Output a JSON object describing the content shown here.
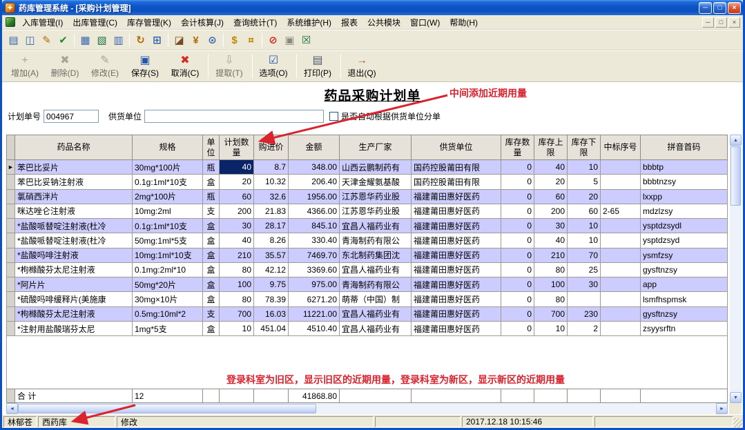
{
  "window": {
    "title": "药库管理系统 - [采购计划管理]",
    "minimize": "─",
    "restore": "□",
    "close": "×"
  },
  "menu": {
    "items": [
      "入库管理(I)",
      "出库管理(C)",
      "库存管理(K)",
      "会计核算(J)",
      "查询统计(T)",
      "系统维护(H)",
      "报表",
      "公共模块",
      "窗口(W)",
      "帮助(H)"
    ],
    "mdi_minimize": "─",
    "mdi_restore": "□",
    "mdi_close": "×"
  },
  "toolbar": {
    "icons": [
      {
        "name": "new-plan-icon",
        "glyph": "▤",
        "color": "#3565b0"
      },
      {
        "name": "copy-plan-icon",
        "glyph": "◫",
        "color": "#3565b0"
      },
      {
        "name": "edit-plan-icon",
        "glyph": "✎",
        "color": "#b06a00"
      },
      {
        "name": "audit-plan-icon",
        "glyph": "✔",
        "color": "#1e8a2e"
      },
      {
        "sep": true
      },
      {
        "name": "notepad-icon",
        "glyph": "▦",
        "color": "#3565b0"
      },
      {
        "name": "excel-export-icon",
        "glyph": "▧",
        "color": "#1e7145"
      },
      {
        "name": "report-icon",
        "glyph": "▥",
        "color": "#3565b0"
      },
      {
        "sep": true
      },
      {
        "name": "refresh-icon",
        "glyph": "↻",
        "color": "#b06a00"
      },
      {
        "name": "data-grid-icon",
        "glyph": "⊞",
        "color": "#3565b0"
      },
      {
        "sep": true
      },
      {
        "name": "image-icon",
        "glyph": "◪",
        "color": "#7a4a20"
      },
      {
        "name": "price-query-icon",
        "glyph": "¥",
        "color": "#b06a00"
      },
      {
        "name": "search-icon",
        "glyph": "⊙",
        "color": "#3565b0"
      },
      {
        "sep": true
      },
      {
        "name": "money-icon",
        "glyph": "$",
        "color": "#c08800"
      },
      {
        "name": "gold-icon",
        "glyph": "¤",
        "color": "#c08800"
      },
      {
        "sep": true
      },
      {
        "name": "stop-icon",
        "glyph": "⊘",
        "color": "#d22c22"
      },
      {
        "name": "save-disk-icon",
        "glyph": "▣",
        "color": "#8a8880"
      },
      {
        "name": "close-grid-icon",
        "glyph": "☒",
        "color": "#1e7145"
      }
    ]
  },
  "actions": [
    {
      "name": "add-button",
      "label": "增加(A)",
      "glyph": "+",
      "color": "#9c9a92",
      "enabled": false
    },
    {
      "name": "delete-button",
      "label": "删除(D)",
      "glyph": "✖",
      "color": "#9c9a92",
      "enabled": false
    },
    {
      "name": "modify-button",
      "label": "修改(E)",
      "glyph": "✎",
      "color": "#9c9a92",
      "enabled": false
    },
    {
      "name": "save-button",
      "label": "保存(S)",
      "glyph": "▣",
      "color": "#2456b0",
      "enabled": true
    },
    {
      "name": "cancel-button",
      "label": "取消(C)",
      "glyph": "✖",
      "color": "#d22c22",
      "enabled": true
    },
    {
      "sep": true
    },
    {
      "name": "extract-button",
      "label": "提取(T)",
      "glyph": "⇩",
      "color": "#9c9a92",
      "enabled": false
    },
    {
      "sep": true
    },
    {
      "name": "options-button",
      "label": "选项(O)",
      "glyph": "☑",
      "color": "#2456b0",
      "enabled": true
    },
    {
      "sep": true
    },
    {
      "name": "print-button",
      "label": "打印(P)",
      "glyph": "▤",
      "color": "#50586e",
      "enabled": true
    },
    {
      "sep": true
    },
    {
      "name": "exit-button",
      "label": "退出(Q)",
      "glyph": "→",
      "color": "#b06030",
      "enabled": true
    }
  ],
  "form": {
    "doc_title": "药品采购计划单",
    "plan_no_label": "计划单号",
    "plan_no_value": "004967",
    "supplier_label": "供货单位",
    "supplier_value": "",
    "checkbox_checked": false,
    "checkbox_label": "是否自动根据供货单位分单"
  },
  "annotations": {
    "top": "中间添加近期用量",
    "bottom": "登录科室为旧区，显示旧区的近期用量，登录科室为新区，显示新区的近期用量",
    "arrow_color": "#d9232e"
  },
  "table": {
    "columns": [
      "药品名称",
      "规格",
      "单位",
      "计划数量",
      "购进价",
      "金额",
      "生产厂家",
      "供货单位",
      "库存数量",
      "库存上限",
      "库存下限",
      "中标序号",
      "拼音首码"
    ],
    "aligns": [
      "l",
      "l",
      "c",
      "r",
      "r",
      "r",
      "l",
      "l",
      "r",
      "r",
      "r",
      "l",
      "l"
    ],
    "pointer": "►",
    "selected": {
      "row": 0,
      "col": 3
    },
    "rows": [
      [
        "苯巴比妥片",
        "30mg*100片",
        "瓶",
        "40",
        "8.7",
        "348.00",
        "山西云鹏制药有",
        "国药控股莆田有限",
        "0",
        "40",
        "10",
        "",
        "bbbtp"
      ],
      [
        "苯巴比妥钠注射液",
        "0.1g:1ml*10支",
        "盒",
        "20",
        "10.32",
        "206.40",
        "天津金耀氨基酸",
        "国药控股莆田有限",
        "0",
        "20",
        "5",
        "",
        "bbbtnzsy"
      ],
      [
        "氯硝西泮片",
        "2mg*100片",
        "瓶",
        "60",
        "32.6",
        "1956.00",
        "江苏恩华药业股",
        "福建莆田惠好医药",
        "0",
        "60",
        "20",
        "",
        "lxxpp"
      ],
      [
        "咪达唑仑注射液",
        "10mg:2ml",
        "支",
        "200",
        "21.83",
        "4366.00",
        "江苏恩华药业股",
        "福建莆田惠好医药",
        "0",
        "200",
        "60",
        "2-65",
        "mdzlzsy"
      ],
      [
        "*盐酸哌替啶注射液(杜冷",
        "0.1g:1ml*10支",
        "盒",
        "30",
        "28.17",
        "845.10",
        "宜昌人福药业有",
        "福建莆田惠好医药",
        "0",
        "30",
        "10",
        "",
        "ysptdzsydl"
      ],
      [
        "*盐酸哌替啶注射液(杜冷",
        "50mg:1ml*5支",
        "盒",
        "40",
        "8.26",
        "330.40",
        "青海制药有限公",
        "福建莆田惠好医药",
        "0",
        "40",
        "10",
        "",
        "ysptdzsyd"
      ],
      [
        "*盐酸吗啡注射液",
        "10mg:1ml*10支",
        "盒",
        "210",
        "35.57",
        "7469.70",
        "东北制药集团沈",
        "福建莆田惠好医药",
        "0",
        "210",
        "70",
        "",
        "ysmfzsy"
      ],
      [
        "*枸橼酸芬太尼注射液",
        "0.1mg:2ml*10",
        "盒",
        "80",
        "42.12",
        "3369.60",
        "宜昌人福药业有",
        "福建莆田惠好医药",
        "0",
        "80",
        "25",
        "",
        "gysftnzsy"
      ],
      [
        "*阿片片",
        "50mg*20片",
        "盒",
        "100",
        "9.75",
        "975.00",
        "青海制药有限公",
        "福建莆田惠好医药",
        "0",
        "100",
        "30",
        "",
        "app"
      ],
      [
        "*硫酸吗啡缓释片(美施康",
        "30mg×10片",
        "盒",
        "80",
        "78.39",
        "6271.20",
        "萌蒂（中国）制",
        "福建莆田惠好医药",
        "0",
        "80",
        "",
        "",
        "lsmfhspmsk"
      ],
      [
        "*枸橼酸芬太尼注射液",
        "0.5mg:10ml*2",
        "支",
        "700",
        "16.03",
        "11221.00",
        "宜昌人福药业有",
        "福建莆田惠好医药",
        "0",
        "700",
        "230",
        "",
        "gysftnzsy"
      ],
      [
        "*注射用盐酸瑞芬太尼",
        "1mg*5支",
        "盒",
        "10",
        "451.04",
        "4510.40",
        "宜昌人福药业有",
        "福建莆田惠好医药",
        "0",
        "10",
        "2",
        "",
        "zsyysrftn"
      ]
    ],
    "total": {
      "label": "合  计",
      "count": "12",
      "amount": "41868.80"
    }
  },
  "scrollbar": {
    "up": "▲",
    "down": "▼",
    "left": "◄",
    "right": "►"
  },
  "statusbar": {
    "user": "林郁苍",
    "department": "西药库",
    "mode": "修改",
    "datetime": "2017.12.18 10:15:46"
  },
  "colors": {
    "titlebar": "#0b51c6",
    "row_alt": "#ccccff",
    "selection": "#0a246a",
    "annotation_red": "#d9232e"
  }
}
